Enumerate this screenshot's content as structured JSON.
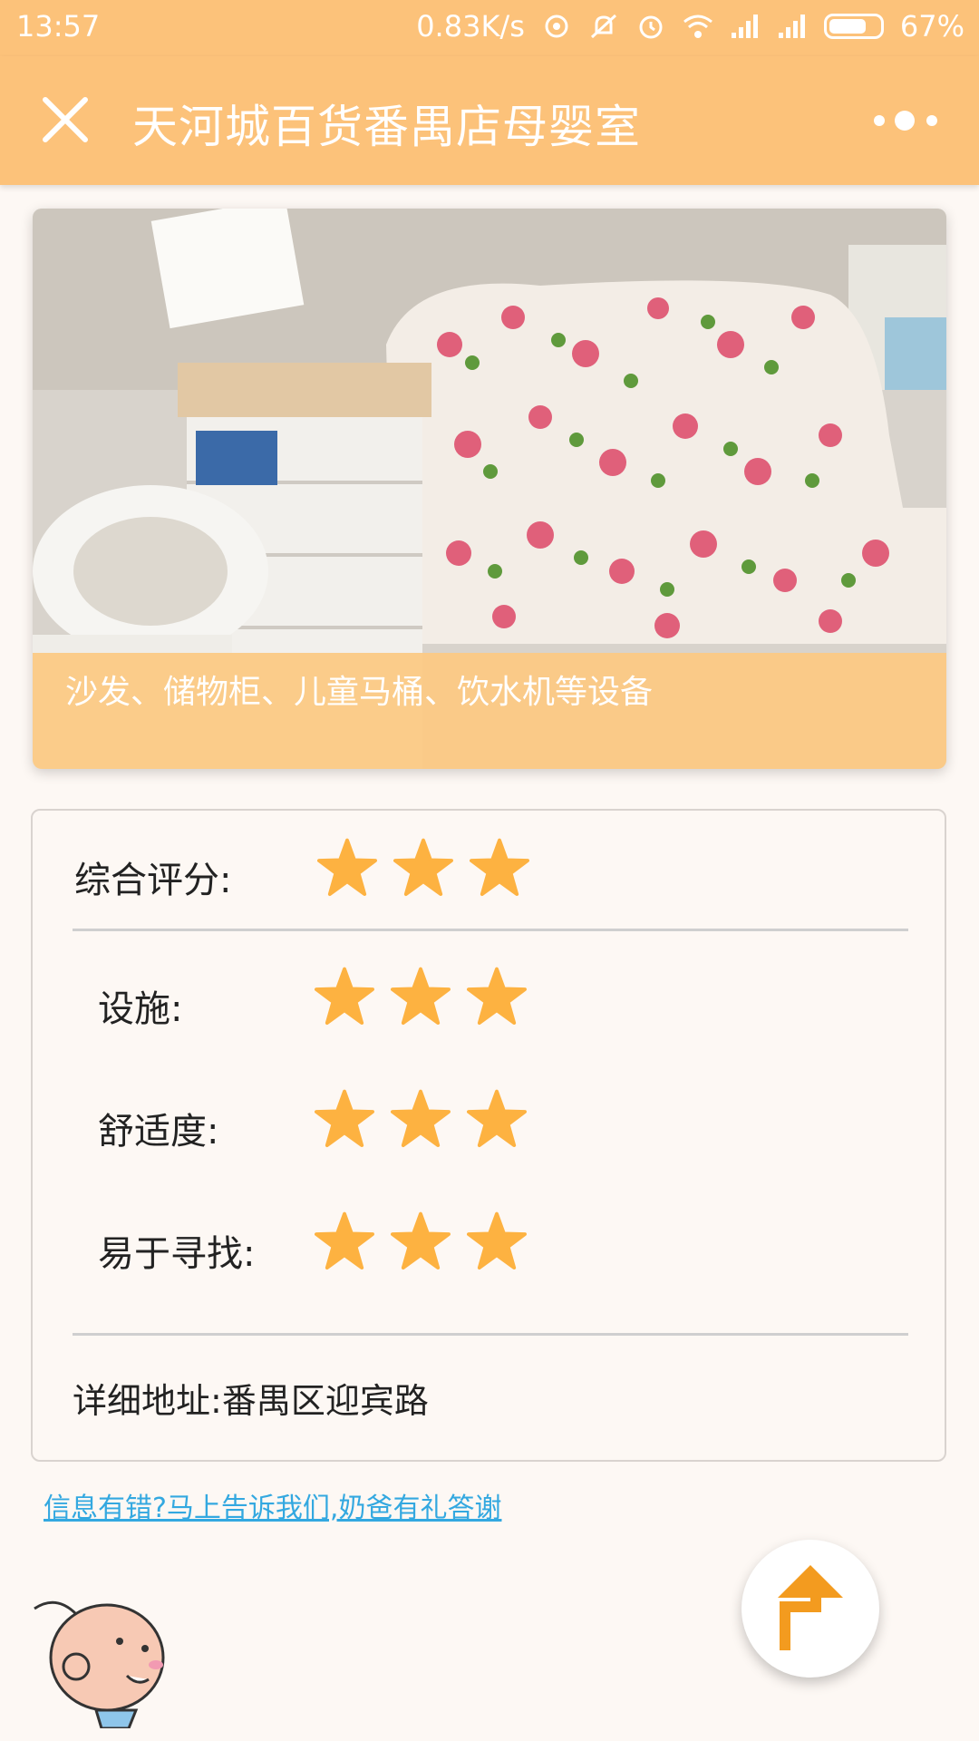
{
  "status_bar": {
    "time": "13:57",
    "speed": "0.83K/s",
    "battery": "67%",
    "icons": [
      "data-sync-icon",
      "mute-icon",
      "alarm-icon",
      "wifi-icon",
      "signal-icon",
      "signal-icon",
      "battery-icon"
    ]
  },
  "header": {
    "title": "天河城百货番禺店母婴室",
    "close_icon": "close-icon",
    "more_icon": "more-icon",
    "color": "#fcc27a"
  },
  "photo": {
    "caption": "沙发、储物柜、儿童马桶、饮水机等设备"
  },
  "ratings": {
    "overall": {
      "label": "综合评分:",
      "stars": 3
    },
    "items": [
      {
        "label": "设施:",
        "stars": 3
      },
      {
        "label": "舒适度:",
        "stars": 3
      },
      {
        "label": "易于寻找:",
        "stars": 3
      }
    ],
    "star_color": "#fdb241"
  },
  "address": {
    "label": "详细地址:",
    "value": "番禺区迎宾路"
  },
  "report_link": "信息有错?马上告诉我们,奶爸有礼答谢",
  "fab": {
    "icon": "directions-icon",
    "color": "#f39b1f"
  }
}
